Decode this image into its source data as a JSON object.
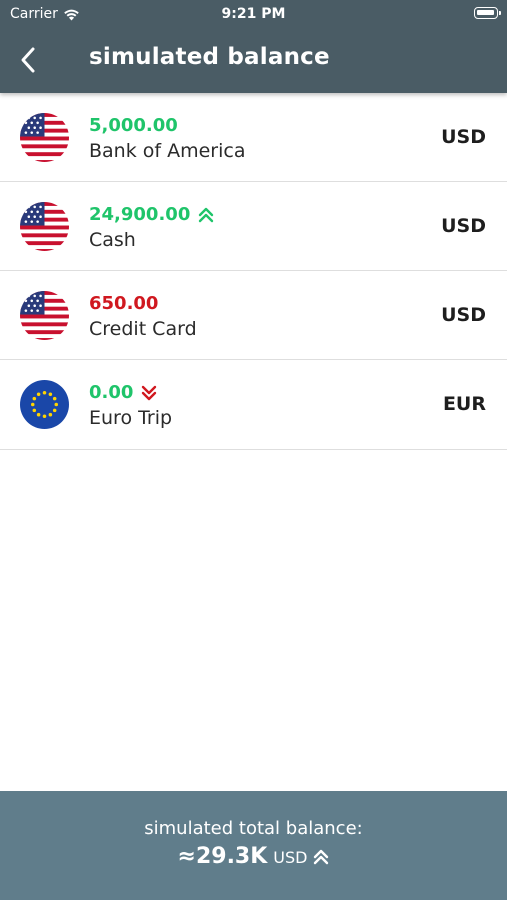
{
  "status_bar": {
    "carrier": "Carrier",
    "time": "9:21 PM"
  },
  "header": {
    "title": "simulated balance",
    "background": "#4a5c65"
  },
  "accounts": [
    {
      "amount": "5,000.00",
      "amount_color": "#1fc46a",
      "name": "Bank of America",
      "currency": "USD",
      "flag": "us-flag-icon",
      "trend": "none"
    },
    {
      "amount": "24,900.00",
      "amount_color": "#1fc46a",
      "name": "Cash",
      "currency": "USD",
      "flag": "us-flag-icon",
      "trend": "up"
    },
    {
      "amount": "650.00",
      "amount_color": "#d0181f",
      "name": "Credit Card",
      "currency": "USD",
      "flag": "us-flag-icon",
      "trend": "none"
    },
    {
      "amount": "0.00",
      "amount_color": "#1fc46a",
      "name": "Euro Trip",
      "currency": "EUR",
      "flag": "eu-flag-icon",
      "trend": "down"
    }
  ],
  "footer": {
    "label": "simulated total balance:",
    "total": "≈29.3K",
    "currency": "USD",
    "trend": "up",
    "background": "#607d8b"
  },
  "colors": {
    "positive": "#1fc46a",
    "negative": "#d0181f",
    "trend_up": "#1fc46a",
    "trend_down": "#d0181f"
  }
}
